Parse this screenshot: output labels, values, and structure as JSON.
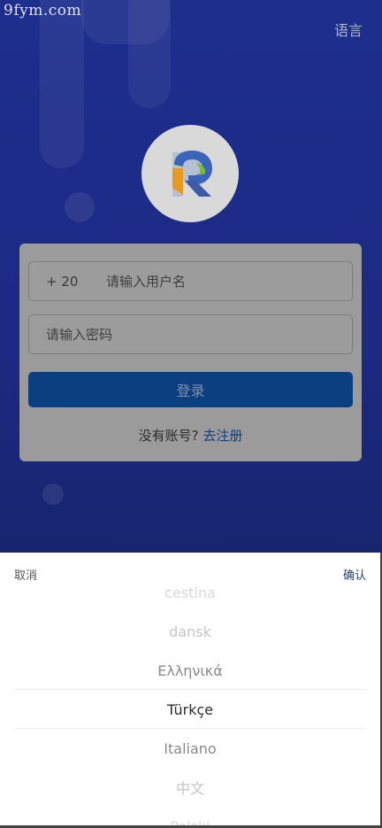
{
  "watermark": "9fym.com",
  "header": {
    "language_label": "语言"
  },
  "login": {
    "country_code": "+ 20",
    "username_placeholder": "请输入用户名",
    "password_placeholder": "请输入密码",
    "login_label": "登录",
    "no_account_text": "没有账号? ",
    "register_link": "去注册"
  },
  "language_sheet": {
    "cancel_label": "取消",
    "confirm_label": "确认",
    "options": [
      "cestina",
      "dansk",
      "Ελληνικά",
      "Türkçe",
      "Italiano",
      "中文",
      "Polski"
    ],
    "selected": "Türkçe"
  },
  "colors": {
    "background": "#1c2b88",
    "register_link": "#0b3f82",
    "login_button": "#0c3f7f"
  },
  "icons": {
    "logo": "r-letter-logo"
  }
}
